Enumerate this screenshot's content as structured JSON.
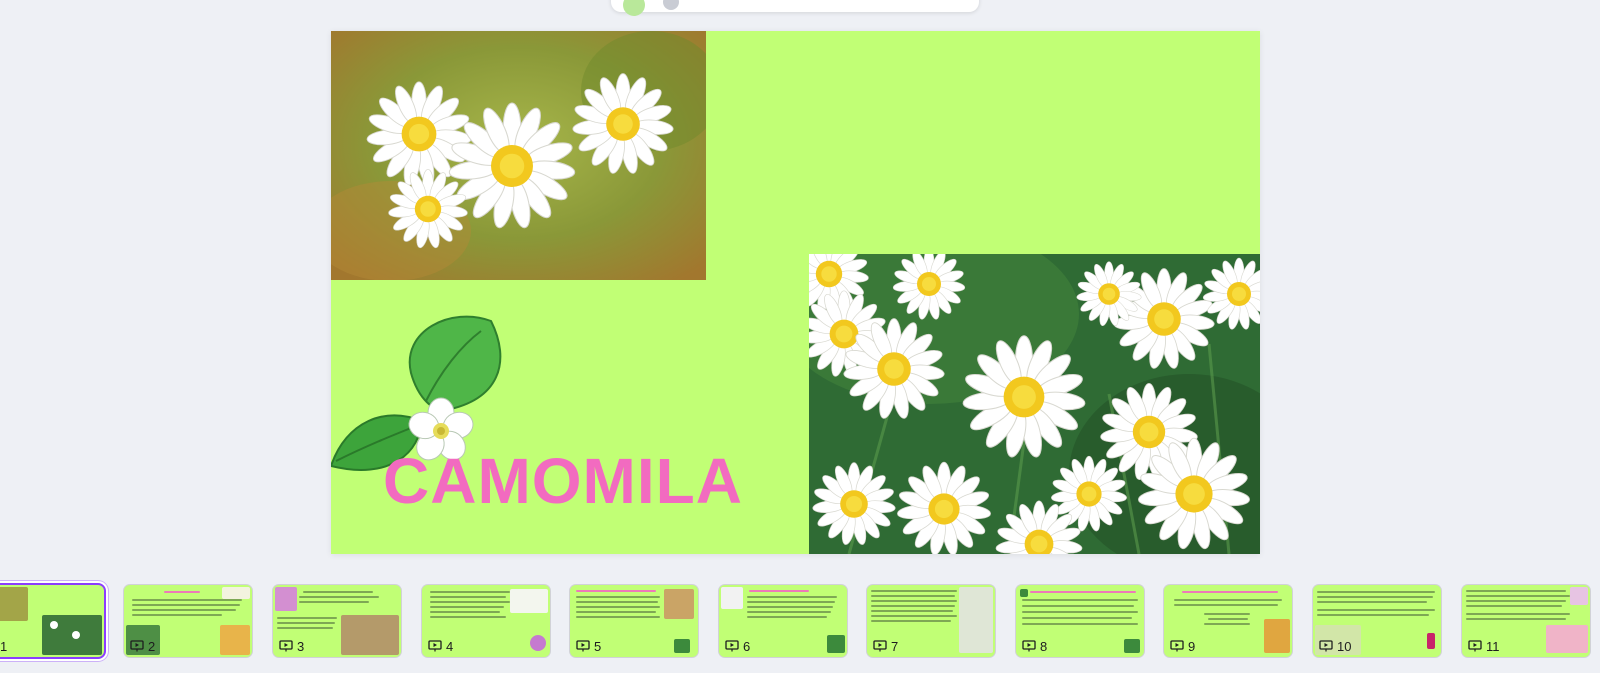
{
  "slide": {
    "title": "CAMOMILA",
    "background_color": "#c1ff75",
    "title_color": "#f26bc0"
  },
  "filmstrip": {
    "selected_index": 1,
    "thumbnails": [
      {
        "number": "1"
      },
      {
        "number": "2"
      },
      {
        "number": "3"
      },
      {
        "number": "4"
      },
      {
        "number": "5"
      },
      {
        "number": "6"
      },
      {
        "number": "7"
      },
      {
        "number": "8"
      },
      {
        "number": "9"
      },
      {
        "number": "10"
      },
      {
        "number": "11"
      }
    ],
    "icon": "present-icon"
  },
  "colors": {
    "accent": "#8b3dff",
    "app_background": "#eef0f5"
  }
}
